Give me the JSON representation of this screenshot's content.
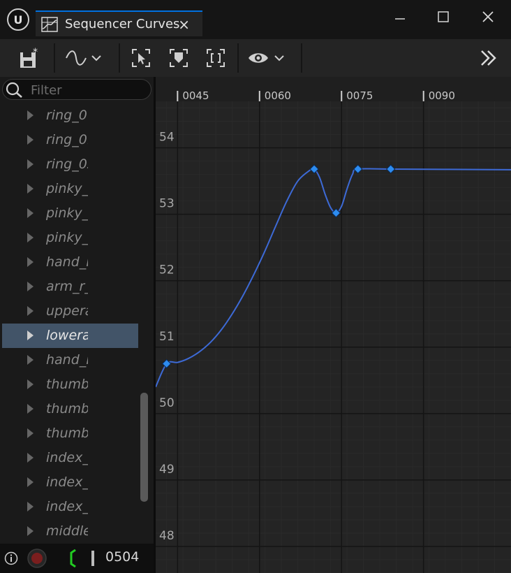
{
  "window": {
    "tab_title": "Sequencer Curves",
    "tab_close": "×",
    "minimize": "–",
    "maximize": "☐",
    "close": "✕"
  },
  "toolbar": {
    "icons": [
      "save-icon",
      "curve-interpolation-icon",
      "select-icon",
      "key-icon",
      "frame-icon",
      "view-icon",
      "more-icon"
    ],
    "more_label": "»"
  },
  "filter": {
    "placeholder": "Filter"
  },
  "tree": {
    "items": [
      {
        "label": "ring_0",
        "selected": false
      },
      {
        "label": "ring_0:",
        "selected": false
      },
      {
        "label": "ring_03",
        "selected": false
      },
      {
        "label": "pinky_",
        "selected": false
      },
      {
        "label": "pinky_",
        "selected": false
      },
      {
        "label": "pinky_",
        "selected": false
      },
      {
        "label": "hand_r",
        "selected": false
      },
      {
        "label": "arm_r_",
        "selected": false
      },
      {
        "label": "uppera",
        "selected": false
      },
      {
        "label": "lowera",
        "selected": true
      },
      {
        "label": "hand_r",
        "selected": false
      },
      {
        "label": "thumb",
        "selected": false
      },
      {
        "label": "thumb",
        "selected": false
      },
      {
        "label": "thumb",
        "selected": false
      },
      {
        "label": "index_",
        "selected": false
      },
      {
        "label": "index_",
        "selected": false
      },
      {
        "label": "index_",
        "selected": false
      },
      {
        "label": "middle",
        "selected": false
      }
    ]
  },
  "status": {
    "frame": "0504"
  },
  "colors": {
    "accent": "#0070e0",
    "curve": "#3d6ad6",
    "key": "#2d8cf0",
    "selection": "#425468",
    "range_marker": "#22cc22"
  },
  "chart_data": {
    "type": "line",
    "x_ticks": [
      "0045",
      "0060",
      "0075",
      "0090"
    ],
    "y_ticks": [
      "48",
      "49",
      "50",
      "51",
      "52",
      "53",
      "54"
    ],
    "xlim": [
      41,
      106
    ],
    "ylim": [
      47.6,
      54.7
    ],
    "keys": [
      {
        "x": 43,
        "y": 50.75
      },
      {
        "x": 70,
        "y": 53.68
      },
      {
        "x": 74,
        "y": 53.02
      },
      {
        "x": 78,
        "y": 53.68
      },
      {
        "x": 84,
        "y": 53.68
      }
    ],
    "curve": [
      {
        "x": 41,
        "y": 50.4
      },
      {
        "x": 43,
        "y": 50.75
      },
      {
        "x": 45,
        "y": 50.77
      },
      {
        "x": 47,
        "y": 50.83
      },
      {
        "x": 49,
        "y": 50.93
      },
      {
        "x": 51,
        "y": 51.07
      },
      {
        "x": 53,
        "y": 51.26
      },
      {
        "x": 55,
        "y": 51.5
      },
      {
        "x": 57,
        "y": 51.78
      },
      {
        "x": 59,
        "y": 52.1
      },
      {
        "x": 61,
        "y": 52.45
      },
      {
        "x": 63,
        "y": 52.83
      },
      {
        "x": 65,
        "y": 53.2
      },
      {
        "x": 67,
        "y": 53.5
      },
      {
        "x": 69,
        "y": 53.65
      },
      {
        "x": 70,
        "y": 53.68
      },
      {
        "x": 71,
        "y": 53.55
      },
      {
        "x": 72,
        "y": 53.3
      },
      {
        "x": 73,
        "y": 53.1
      },
      {
        "x": 74,
        "y": 53.02
      },
      {
        "x": 75,
        "y": 53.12
      },
      {
        "x": 76,
        "y": 53.38
      },
      {
        "x": 77,
        "y": 53.6
      },
      {
        "x": 78,
        "y": 53.68
      },
      {
        "x": 84,
        "y": 53.68
      },
      {
        "x": 106,
        "y": 53.67
      }
    ]
  }
}
